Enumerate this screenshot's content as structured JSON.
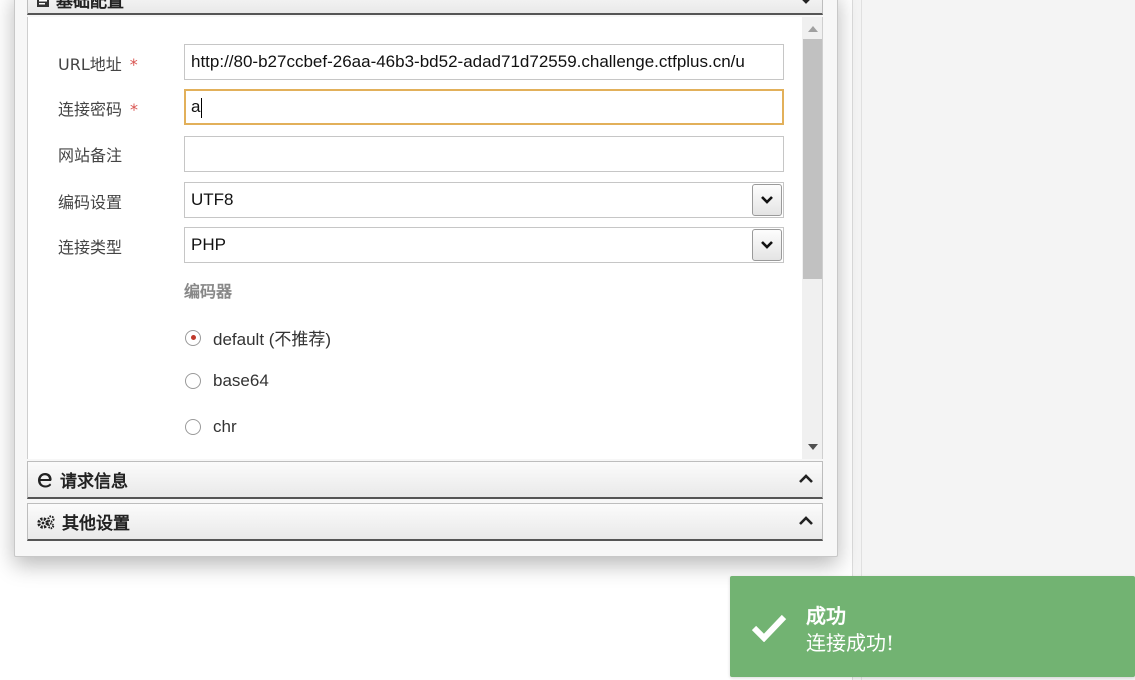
{
  "sections": {
    "basic": {
      "title": "基础配置"
    },
    "request": {
      "title": "请求信息"
    },
    "other": {
      "title": "其他设置"
    }
  },
  "form": {
    "url": {
      "label": "URL地址",
      "required_mark": "*",
      "value": "http://80-b27ccbef-26aa-46b3-bd52-adad71d72559.challenge.ctfplus.cn/u"
    },
    "password": {
      "label": "连接密码",
      "required_mark": "*",
      "value": "a"
    },
    "note": {
      "label": "网站备注",
      "value": ""
    },
    "encoding": {
      "label": "编码设置",
      "selected": "UTF8"
    },
    "type": {
      "label": "连接类型",
      "selected": "PHP"
    },
    "encoder": {
      "heading": "编码器",
      "options": [
        {
          "label": "default (不推荐)",
          "checked": true
        },
        {
          "label": "base64",
          "checked": false
        },
        {
          "label": "chr",
          "checked": false
        }
      ]
    }
  },
  "toast": {
    "title": "成功",
    "message": "连接成功!",
    "color": "#72b372"
  },
  "colors": {
    "focus_border": "#e2b05a",
    "required": "#d9534f"
  },
  "icons": {
    "basic": "file-icon",
    "request": "ie-icon",
    "other": "gears-icon"
  }
}
